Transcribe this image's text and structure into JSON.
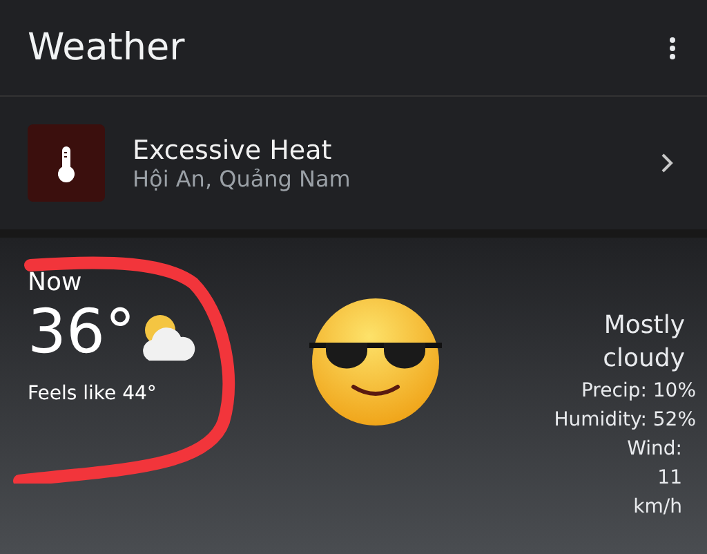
{
  "app_bar": {
    "title": "Weather"
  },
  "alert": {
    "title": "Excessive Heat",
    "location": "Hội An, Quảng Nam"
  },
  "current": {
    "label": "Now",
    "temperature": "36°",
    "feels_like": "Feels like 44°",
    "condition": "Mostly cloudy",
    "details": [
      {
        "text": "Precip: 10%"
      },
      {
        "text": "Humidity: 52%"
      },
      {
        "text": "Wind: 11 km/h"
      }
    ]
  },
  "sticker": {
    "kind": "sunglasses-emoji"
  },
  "annotation": {
    "kind": "scribble",
    "color": "#f2353b"
  }
}
